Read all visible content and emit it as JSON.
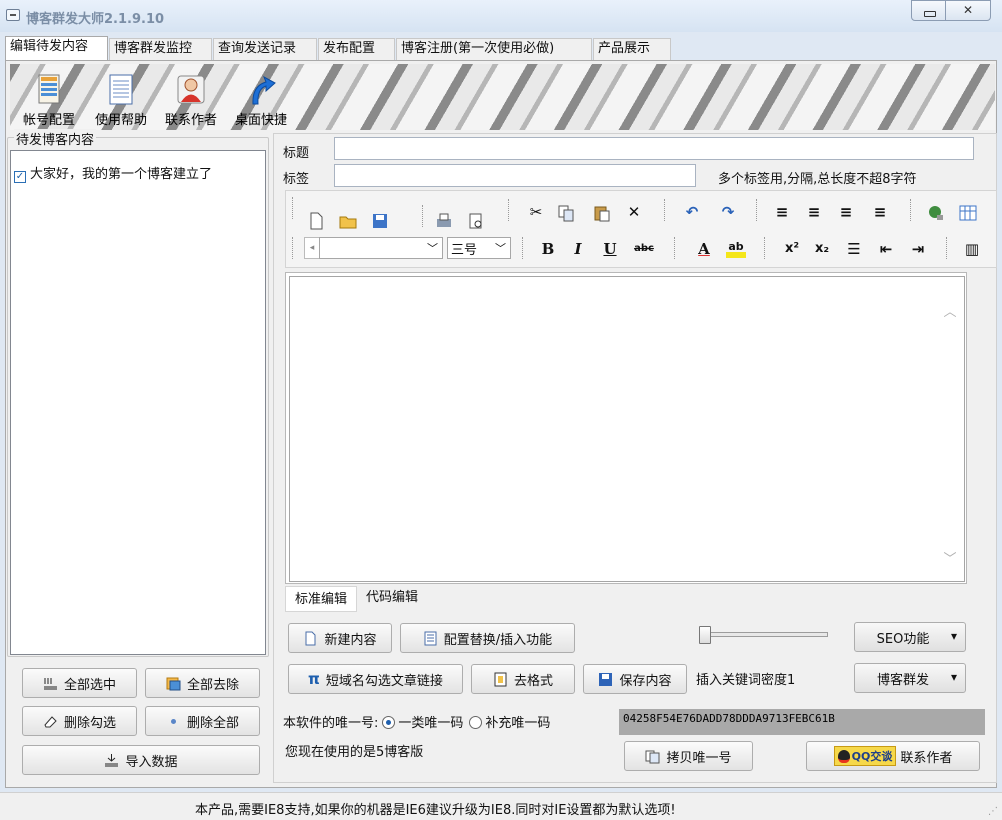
{
  "window": {
    "title": "博客群发大师2.1.9.10",
    "close_glyph": "✕"
  },
  "tabs": [
    {
      "label": "编辑待发内容",
      "active": true
    },
    {
      "label": "博客群发监控"
    },
    {
      "label": "查询发送记录"
    },
    {
      "label": "发布配置"
    },
    {
      "label": "博客注册(第一次使用必做)"
    },
    {
      "label": "产品展示"
    }
  ],
  "toolbar": [
    {
      "label": "帐号配置",
      "icon": "account-config-icon"
    },
    {
      "label": "使用帮助",
      "icon": "help-document-icon"
    },
    {
      "label": "联系作者",
      "icon": "contact-person-icon"
    },
    {
      "label": "桌面快捷",
      "icon": "desktop-shortcut-arrow-icon"
    }
  ],
  "left": {
    "group_title": "待发博客内容",
    "items": [
      {
        "text": "大家好，我的第一个博客建立了",
        "checked": true
      }
    ],
    "buttons": {
      "select_all": "全部选中",
      "deselect_all": "全部去除",
      "delete_checked": "删除勾选",
      "delete_all": "删除全部",
      "import": "导入数据"
    }
  },
  "form": {
    "title_label": "标题",
    "title_value": "",
    "tags_label": "标签",
    "tags_value": "",
    "tags_hint": "多个标签用,分隔,总长度不超8字符"
  },
  "rte": {
    "font_value": "",
    "size_value": "三号",
    "bold": "B",
    "italic": "I",
    "underline": "U",
    "strike": "abc",
    "font_color": "A",
    "highlight": "ab",
    "superscript": "x²",
    "subscript": "x₂"
  },
  "editor_modes": {
    "standard": "标准编辑",
    "code": "代码编辑"
  },
  "actions": {
    "new": "新建内容",
    "config_replace": "配置替换/插入功能",
    "seo": "SEO功能",
    "short_link": "短域名勾选文章链接",
    "clear_format": "去格式",
    "save": "保存内容",
    "keyword_density_label": "插入关键词密度1",
    "mass_send": "博客群发"
  },
  "uid": {
    "label": "本软件的唯一号:",
    "option1": "一类唯一码",
    "option2": "补充唯一码",
    "selected": "一类唯一码",
    "value": "04258F54E76DADD78DDDA9713FEBC61B",
    "version_text": "您现在使用的是5博客版",
    "copy_button": "拷贝唯一号",
    "qq_label": "QQ交谈",
    "contact_label": "联系作者"
  },
  "status": {
    "text": "本产品,需要IE8支持,如果你的机器是IE6建议升级为IE8.同时对IE设置都为默认选项!"
  },
  "colors": {
    "accent": "#1e5fae",
    "title_text": "#7b8ea6",
    "uid_bg": "#a9a9a9"
  }
}
